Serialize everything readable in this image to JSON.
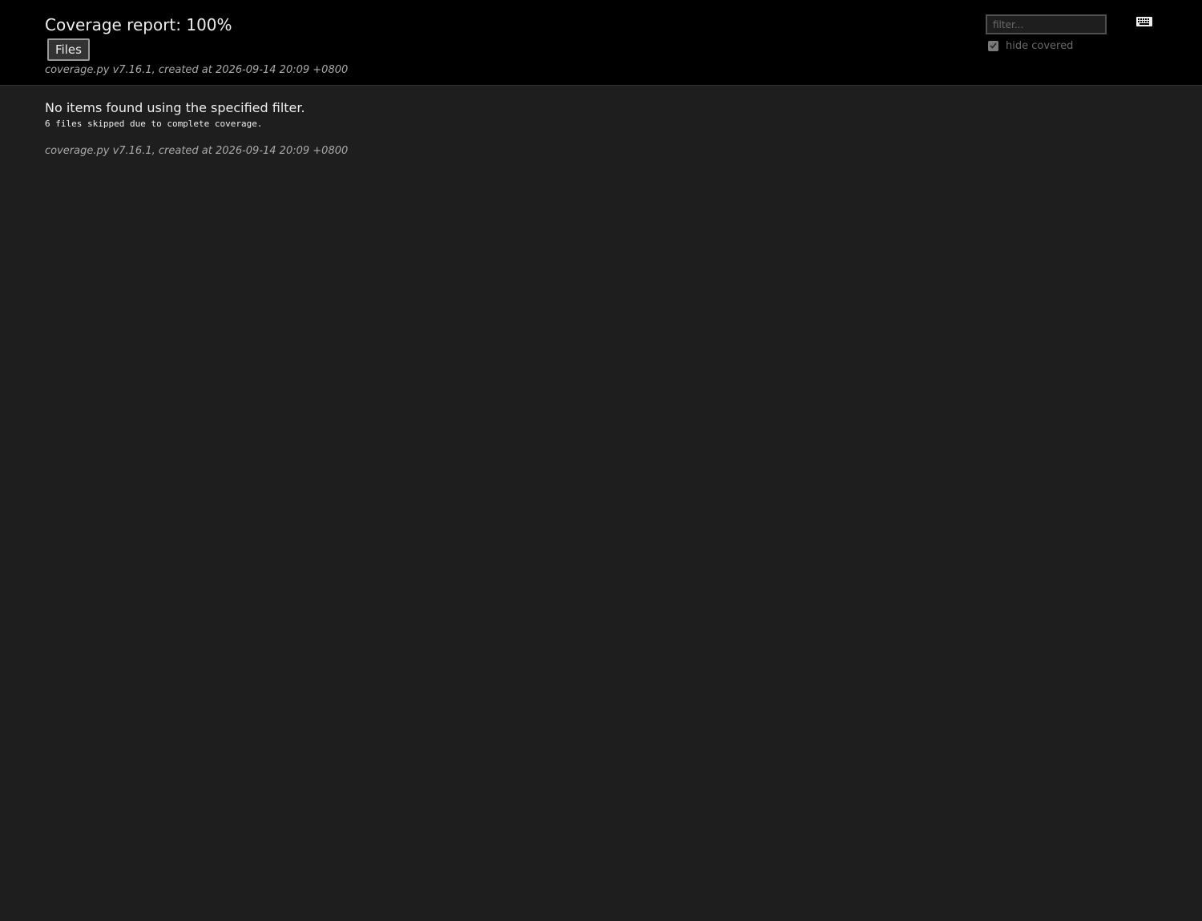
{
  "header": {
    "title": "Coverage report: 100%",
    "files_button_label": "Files",
    "meta_text": "coverage.py v7.16.1, created at 2026-09-14 20:09 +0800",
    "filter": {
      "value": "",
      "placeholder": "filter..."
    },
    "hide_covered": {
      "label": "hide covered",
      "checked": true,
      "disabled": true
    },
    "keyboard_icon": "keyboard-icon"
  },
  "main": {
    "message": "No items found using the specified filter.",
    "skipped_text": "6 files skipped due to complete coverage."
  },
  "footer": {
    "meta_text": "coverage.py v7.16.1, created at 2026-09-14 20:09 +0800"
  },
  "colors": {
    "header_background": "#000000",
    "page_background": "#1e1e1e",
    "text": "#eeeeee",
    "muted_text": "#aaaaaa",
    "disabled_text": "#6a6a6a"
  }
}
